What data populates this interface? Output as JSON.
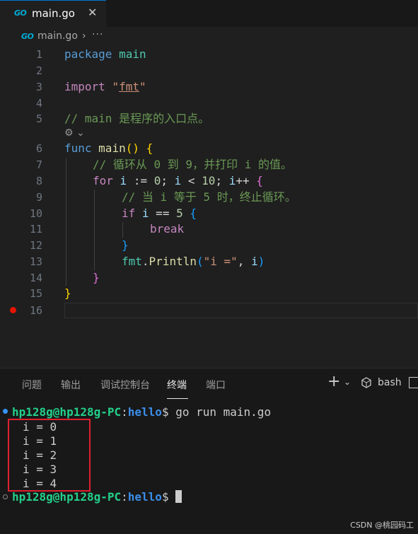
{
  "editor_tab": {
    "icon_text": "GO",
    "filename": "main.go",
    "close_glyph": "✕"
  },
  "breadcrumb": {
    "icon_text": "GO",
    "file": "main.go",
    "separator": "›",
    "more": "···"
  },
  "editor": {
    "line_numbers": [
      "1",
      "2",
      "3",
      "4",
      "5",
      "",
      "6",
      "7",
      "8",
      "9",
      "10",
      "11",
      "12",
      "13",
      "14",
      "15",
      "16"
    ],
    "line1": {
      "kw": "package",
      "name": "main"
    },
    "line3": {
      "kw": "import",
      "q1": "\"",
      "pkg": "fmt",
      "q2": "\""
    },
    "line5": {
      "comment": "// main 是程序的入口点。"
    },
    "codelens": {
      "icon": "⚙",
      "chevron": "⌄"
    },
    "line6": {
      "kw": "func",
      "name": "main",
      "parens": "()",
      "brace": "{"
    },
    "line7": {
      "comment": "// 循环从 0 到 9，并打印 i 的值。"
    },
    "line8": {
      "kw": "for",
      "i1": "i",
      "op1": " := ",
      "n0": "0",
      "semi1": "; ",
      "i2": "i",
      "op2": " < ",
      "n10": "10",
      "semi2": "; ",
      "i3": "i",
      "op3": "++ ",
      "brace": "{"
    },
    "line9": {
      "comment": "// 当 i 等于 5 时，终止循环。"
    },
    "line10": {
      "kw": "if",
      "i": "i",
      "op": " == ",
      "n5": "5",
      "brace": "{"
    },
    "line11": {
      "kw": "break"
    },
    "line12": {
      "brace": "}"
    },
    "line13": {
      "pkg": "fmt",
      "dot": ".",
      "fn": "Println",
      "lp": "(",
      "str": "\"i =\"",
      "comma": ", ",
      "arg": "i",
      "rp": ")"
    },
    "line14": {
      "brace": "}"
    },
    "line15": {
      "brace": "}"
    }
  },
  "panel": {
    "tabs": [
      "问题",
      "输出",
      "调试控制台",
      "终端",
      "端口"
    ],
    "active_tab": "终端",
    "plus": "+",
    "chevron": "⌄",
    "shell": "bash"
  },
  "terminal": {
    "user_host": "hp128g@hp128g-PC",
    "colon": ":",
    "path": "hello",
    "dollar": "$",
    "command": " go run main.go",
    "output": [
      "i = 0",
      "i = 1",
      "i = 2",
      "i = 3",
      "i = 4"
    ]
  },
  "watermark": "CSDN @桃园码工",
  "colors": {
    "accent": "#0078d4",
    "prompt_user": "#23d18b",
    "prompt_path": "#3b8eea",
    "highlight_box": "#e0202e",
    "breakpoint": "#e51400"
  }
}
